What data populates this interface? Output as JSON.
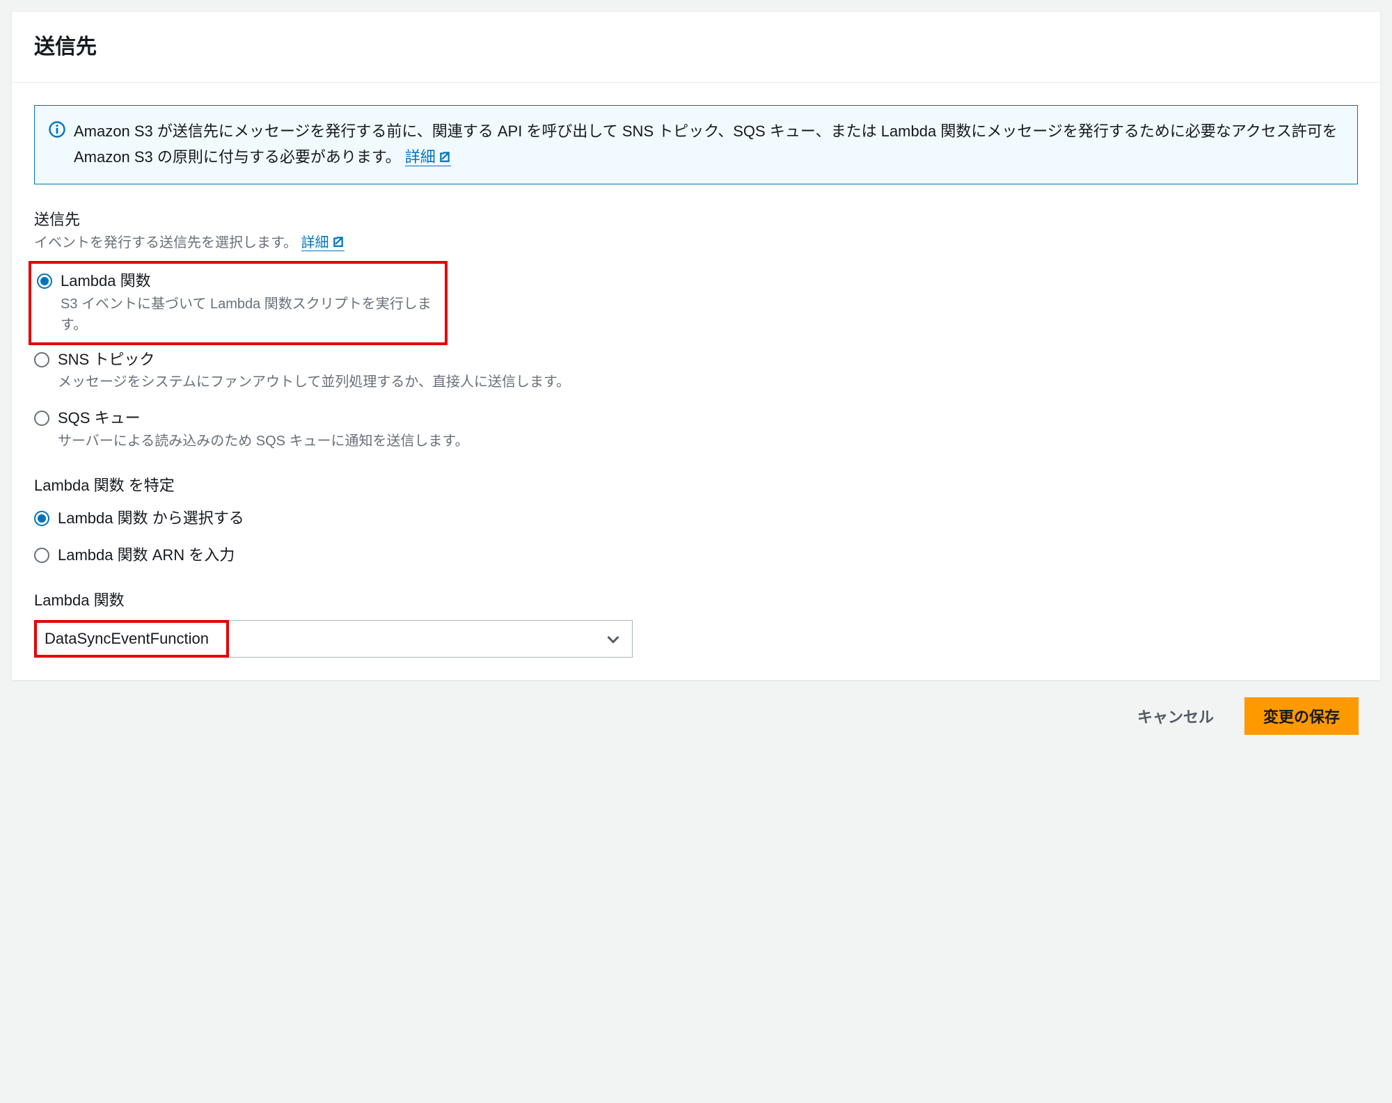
{
  "header": {
    "title": "送信先"
  },
  "info_box": {
    "text_before_link": "Amazon S3 が送信先にメッセージを発行する前に、関連する API を呼び出して SNS トピック、SQS キュー、または Lambda 関数にメッセージを発行するために必要なアクセス許可を Amazon S3 の原則に付与する必要があります。",
    "link_label": "詳細"
  },
  "destination_section": {
    "label": "送信先",
    "description": "イベントを発行する送信先を選択します。",
    "link_label": "詳細",
    "options": [
      {
        "label": "Lambda 関数",
        "description": "S3 イベントに基づいて Lambda 関数スクリプトを実行します。",
        "selected": true
      },
      {
        "label": "SNS トピック",
        "description": "メッセージをシステムにファンアウトして並列処理するか、直接人に送信します。",
        "selected": false
      },
      {
        "label": "SQS キュー",
        "description": "サーバーによる読み込みのため SQS キューに通知を送信します。",
        "selected": false
      }
    ]
  },
  "specify_section": {
    "label": "Lambda 関数 を特定",
    "options": [
      {
        "label": "Lambda 関数 から選択する",
        "selected": true
      },
      {
        "label": "Lambda 関数 ARN を入力",
        "selected": false
      }
    ]
  },
  "lambda_select": {
    "label": "Lambda 関数",
    "value": "DataSyncEventFunction"
  },
  "footer": {
    "cancel": "キャンセル",
    "save": "変更の保存"
  }
}
